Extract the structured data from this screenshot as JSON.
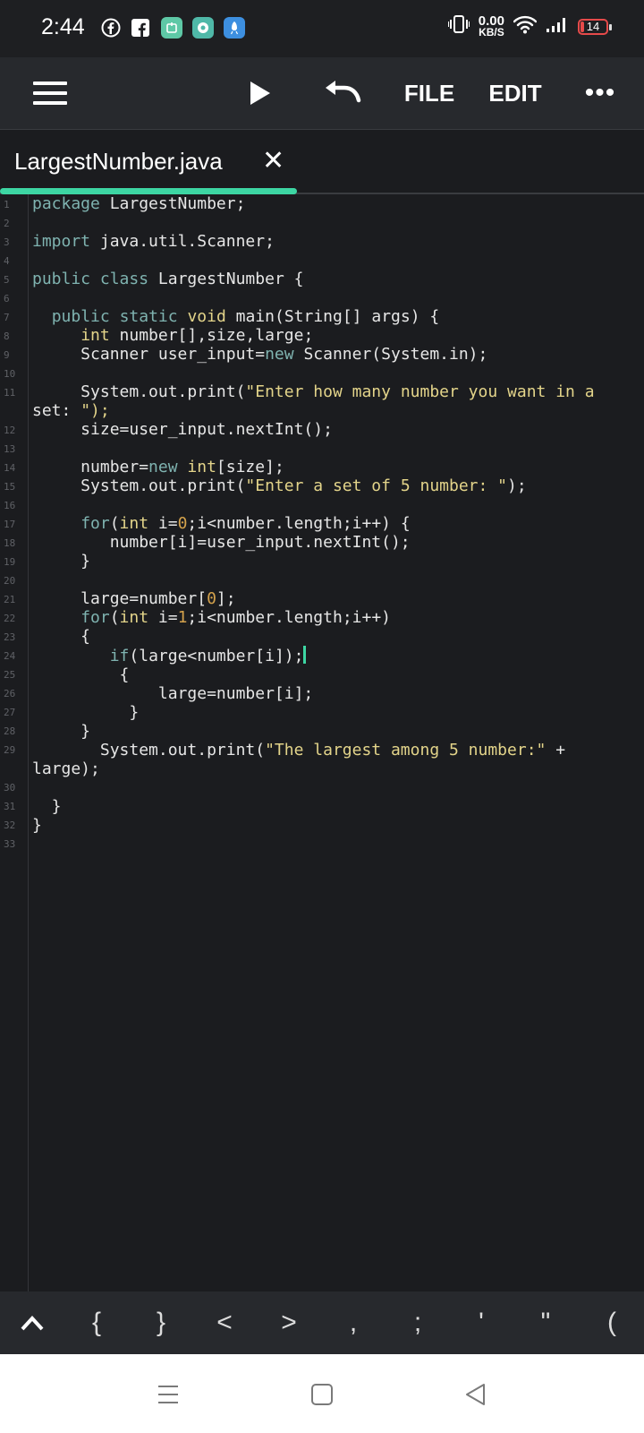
{
  "status_bar": {
    "time": "2:44",
    "net_speed_value": "0.00",
    "net_speed_unit": "KB/S",
    "battery_level": "14",
    "icons": [
      "facebook-icon",
      "facebook-square-icon",
      "app-icon-green",
      "chat-app-icon",
      "rocket-app-icon",
      "vibrate-icon",
      "wifi-icon",
      "signal-icon",
      "battery-icon"
    ]
  },
  "toolbar": {
    "menu_icon": "hamburger-menu-icon",
    "run_icon": "play-icon",
    "undo_icon": "undo-icon",
    "file_label": "FILE",
    "edit_label": "EDIT",
    "more_label": "•••"
  },
  "tab": {
    "title": "LargestNumber.java",
    "close": "✕"
  },
  "editor": {
    "line_count": 33,
    "code_lines": [
      "package LargestNumber;",
      "",
      "import java.util.Scanner;",
      "",
      "public class LargestNumber {",
      "",
      "  public static void main(String[] args) {",
      "     int number[],size,large;",
      "     Scanner user_input=new Scanner(System.in);",
      "",
      "     System.out.print(\"Enter how many number you want in a",
      "set: \");",
      "     size=user_input.nextInt();",
      "",
      "     number=new int[size];",
      "     System.out.print(\"Enter a set of 5 number: \");",
      "",
      "     for(int i=0;i<number.length;i++) {",
      "        number[i]=user_input.nextInt();",
      "     }",
      "",
      "     large=number[0];",
      "     for(int i=1;i<number.length;i++)",
      "     {",
      "        if(large<number[i]);",
      "         {",
      "             large=number[i];",
      "          }",
      "     }",
      "       System.out.print(\"The largest among 5 number:\" +",
      "large);",
      "",
      "  }",
      "}"
    ]
  },
  "symbol_bar": {
    "keys": [
      "^",
      "{",
      "}",
      "<",
      ">",
      ",",
      ";",
      "'",
      "\"",
      "("
    ]
  },
  "nav_bar": {
    "icons": [
      "recent-apps-icon",
      "home-icon",
      "back-icon"
    ]
  },
  "colors": {
    "accent": "#3dd6a3",
    "keyword": "#7fb3b0",
    "type_string": "#e3d48a",
    "number": "#d4a24c",
    "background": "#1b1c1f",
    "toolbar": "#27292d"
  }
}
